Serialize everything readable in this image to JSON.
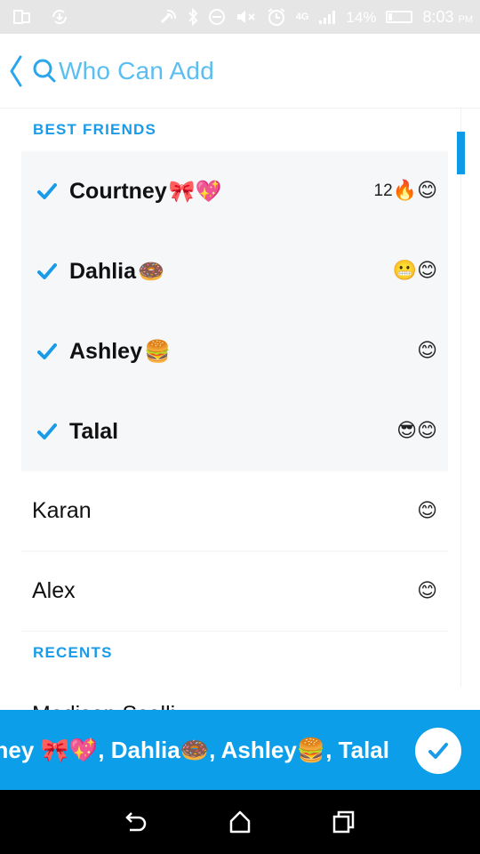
{
  "status_bar": {
    "battery_percent": "14%",
    "time": "8:03",
    "ampm": "PM",
    "network": "4G",
    "icons_left": [
      "screen-mirror-icon",
      "sync-icon"
    ],
    "icons_right": [
      "nfc-icon",
      "bluetooth-icon",
      "do-not-disturb-icon",
      "mute-icon",
      "alarm-icon",
      "4g-lte-icon",
      "signal-icon",
      "battery-icon"
    ]
  },
  "header": {
    "title": "Who Can Add",
    "back_icon": "chevron-left-icon",
    "search_icon": "search-icon"
  },
  "colors": {
    "accent": "#0d9eea",
    "title": "#5bbef0",
    "selected_row_bg": "#f6f7f9"
  },
  "sections": [
    {
      "title": "BEST FRIENDS",
      "rows": [
        {
          "name": "Courtney",
          "name_emoji": "🎀💖",
          "selected": true,
          "streak": "12",
          "badges": "🔥😊"
        },
        {
          "name": "Dahlia",
          "name_emoji": "🍩",
          "selected": true,
          "streak": "",
          "badges": "😬😊"
        },
        {
          "name": "Ashley",
          "name_emoji": "🍔",
          "selected": true,
          "streak": "",
          "badges": "😊"
        },
        {
          "name": "Talal",
          "name_emoji": "",
          "selected": true,
          "streak": "",
          "badges": "😎😊"
        },
        {
          "name": "Karan",
          "name_emoji": "",
          "selected": false,
          "streak": "",
          "badges": "😊"
        },
        {
          "name": "Alex",
          "name_emoji": "",
          "selected": false,
          "streak": "",
          "badges": "😊"
        }
      ]
    },
    {
      "title": "RECENTS",
      "rows": [
        {
          "name": "Madison Scolli",
          "partial": true
        }
      ]
    }
  ],
  "selection_bar": {
    "text": "Courtney 🎀💖, Dahlia🍩, Ashley🍔, Talal",
    "confirm_icon": "checkmark-icon"
  },
  "nav_bar": {
    "buttons": [
      "back-icon",
      "home-icon",
      "recents-icon"
    ]
  }
}
